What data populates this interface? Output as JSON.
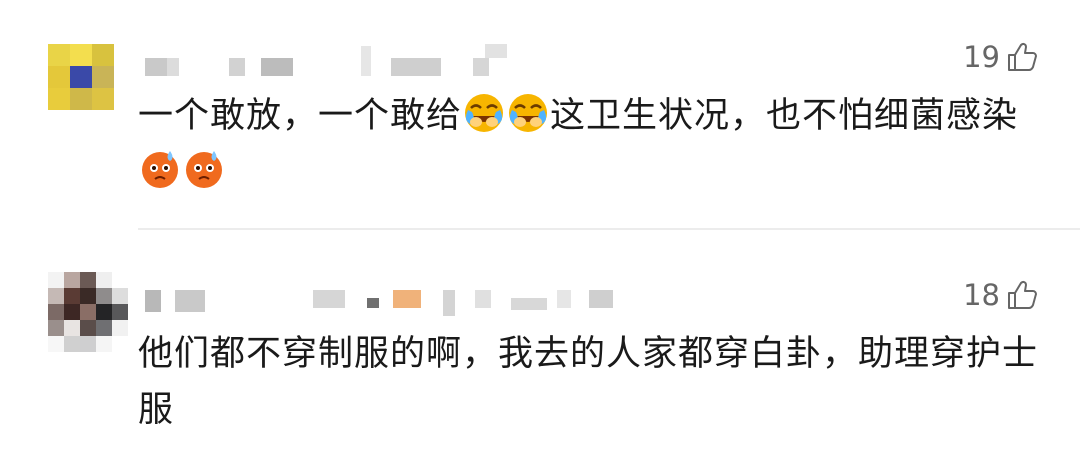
{
  "comments": [
    {
      "likes": "19",
      "text_parts": [
        "一个敢放，一个敢给",
        "这卫生状况，也不怕细菌感染"
      ],
      "emoji": {
        "inline": [
          "laugh-cry-emoji",
          "laugh-cry-emoji"
        ],
        "trailing": [
          "sweat-emoji",
          "sweat-emoji"
        ]
      }
    },
    {
      "likes": "18",
      "text": "他们都不穿制服的啊，我去的人家都穿白卦，助理穿护士服"
    }
  ],
  "colors": {
    "like_text": "#666666",
    "body_text": "#1a1a1a",
    "divider": "#ececec",
    "emoji_face": "#f7b500",
    "emoji_sweat_face": "#f06a1e"
  }
}
